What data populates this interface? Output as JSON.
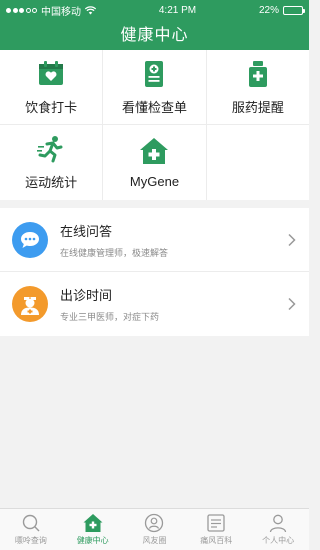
{
  "status": {
    "carrier": "中国移动",
    "time": "4:21 PM",
    "battery": "22%",
    "battery_level": 0.22
  },
  "header": {
    "title": "健康中心"
  },
  "colors": {
    "brand": "#2e9b5f",
    "blue": "#3d9cf0",
    "orange": "#f39a2c"
  },
  "grid": {
    "items": [
      {
        "label": "饮食打卡",
        "icon": "calendar-heart-icon"
      },
      {
        "label": "看懂检查单",
        "icon": "report-plus-icon"
      },
      {
        "label": "服药提醒",
        "icon": "medicine-bottle-icon"
      },
      {
        "label": "运动统计",
        "icon": "running-icon"
      },
      {
        "label": "MyGene",
        "icon": "home-plus-icon"
      }
    ]
  },
  "list": {
    "items": [
      {
        "title": "在线问答",
        "subtitle": "在线健康管理师，极速解答",
        "icon": "chat-bubble-icon"
      },
      {
        "title": "出诊时间",
        "subtitle": "专业三甲医师，对症下药",
        "icon": "doctor-icon"
      }
    ]
  },
  "tabbar": {
    "items": [
      {
        "label": "嘌呤查询",
        "icon": "search-icon",
        "active": false
      },
      {
        "label": "健康中心",
        "icon": "home-plus-icon",
        "active": true
      },
      {
        "label": "风友圈",
        "icon": "community-icon",
        "active": false
      },
      {
        "label": "痛风百科",
        "icon": "encyclopedia-icon",
        "active": false
      },
      {
        "label": "个人中心",
        "icon": "profile-icon",
        "active": false
      }
    ]
  }
}
